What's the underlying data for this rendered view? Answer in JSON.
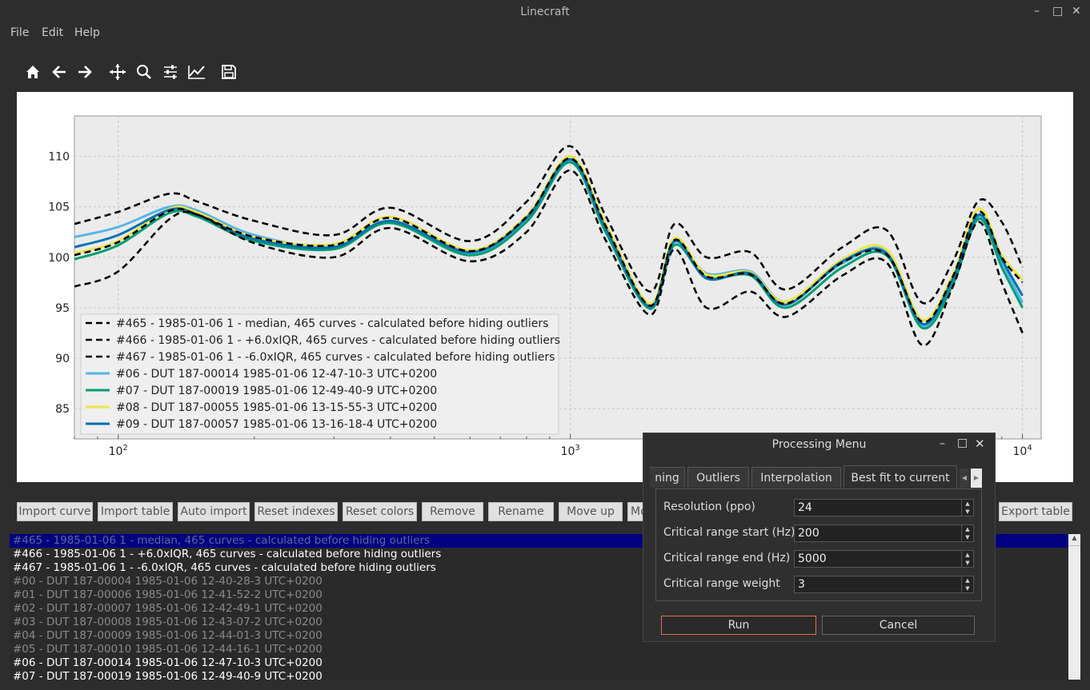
{
  "window": {
    "title": "Linecraft"
  },
  "menu": {
    "items": [
      "File",
      "Edit",
      "Help"
    ]
  },
  "toolbar": {
    "icons": [
      "home-icon",
      "back-icon",
      "forward-icon",
      "pan-icon",
      "zoom-icon",
      "configure-subplots-icon",
      "edit-axis-icon",
      "save-icon"
    ]
  },
  "chart_data": {
    "type": "line",
    "xscale": "log",
    "xlim": [
      80,
      11000
    ],
    "ylim": [
      82,
      114
    ],
    "xticks": [
      "10^2",
      "10^3",
      "10^4"
    ],
    "yticks": [
      85,
      90,
      95,
      100,
      105,
      110
    ],
    "grid": true,
    "legend_position": "lower-left",
    "legend": [
      {
        "label": "#465 - 1985-01-06 1 - median, 465 curves - calculated before hiding outliers",
        "style": "dashed",
        "color": "#000000"
      },
      {
        "label": "#466 - 1985-01-06 1 - +6.0xIQR, 465 curves - calculated before hiding outliers",
        "style": "dashed",
        "color": "#000000"
      },
      {
        "label": "#467 - 1985-01-06 1 - -6.0xIQR, 465 curves - calculated before hiding outliers",
        "style": "dashed",
        "color": "#000000"
      },
      {
        "label": "#06 - DUT 187-00014 1985-01-06 12-47-10-3 UTC+0200",
        "style": "solid",
        "color": "#56b4e9"
      },
      {
        "label": "#07 - DUT 187-00019 1985-01-06 12-49-40-9 UTC+0200",
        "style": "solid",
        "color": "#009e73"
      },
      {
        "label": "#08 - DUT 187-00055 1985-01-06 13-15-55-3 UTC+0200",
        "style": "solid",
        "color": "#f0e442"
      },
      {
        "label": "#09 - DUT 187-00057 1985-01-06 13-16-18-4 UTC+0200",
        "style": "solid",
        "color": "#0072b2"
      }
    ],
    "series": [
      {
        "name": "#465 - 1985-01-06 1 - median, 465 curves - calculated before hiding outliers",
        "color": "#000000",
        "dash": true,
        "x": [
          80,
          100,
          130,
          150,
          200,
          300,
          400,
          600,
          800,
          1000,
          1200,
          1500,
          1700,
          2000,
          2500,
          3000,
          4000,
          5000,
          6000,
          7000,
          8000,
          9000,
          10000
        ],
        "y": [
          100.2,
          101.5,
          104.6,
          104.2,
          102.0,
          101.2,
          103.9,
          100.6,
          104.0,
          109.8,
          103.0,
          95.2,
          101.7,
          98.1,
          98.3,
          95.4,
          99.5,
          100.3,
          93.6,
          98.0,
          104.5,
          100.0,
          97.5
        ]
      },
      {
        "name": "#466 - 1985-01-06 1 - +6.0xIQR, 465 curves - calculated before hiding outliers",
        "color": "#000000",
        "dash": true,
        "x": [
          80,
          100,
          130,
          150,
          200,
          300,
          400,
          600,
          800,
          1000,
          1200,
          1500,
          1700,
          2000,
          2500,
          3000,
          4000,
          5000,
          6000,
          7000,
          8000,
          9000,
          10000
        ],
        "y": [
          103.3,
          104.5,
          106.3,
          105.5,
          103.6,
          102.2,
          104.9,
          101.6,
          105.5,
          111.0,
          104.0,
          96.6,
          103.3,
          100.0,
          100.5,
          96.8,
          101.0,
          102.7,
          95.5,
          99.5,
          105.6,
          103.5,
          99.0
        ]
      },
      {
        "name": "#467 - 1985-01-06 1 - -6.0xIQR, 465 curves - calculated before hiding outliers",
        "color": "#000000",
        "dash": true,
        "x": [
          80,
          100,
          130,
          150,
          200,
          300,
          400,
          600,
          800,
          1000,
          1200,
          1500,
          1700,
          2000,
          2500,
          3000,
          4000,
          5000,
          6000,
          7000,
          8000,
          9000,
          10000
        ],
        "y": [
          97.1,
          98.6,
          103.8,
          104.2,
          101.4,
          100.0,
          102.9,
          99.6,
          102.5,
          108.6,
          101.6,
          94.3,
          100.8,
          95.0,
          96.6,
          94.1,
          98.2,
          99.5,
          91.3,
          97.0,
          103.5,
          97.5,
          92.5
        ]
      },
      {
        "name": "#06 - DUT 187-00014 1985-01-06 12-47-10-3 UTC+0200",
        "color": "#56b4e9",
        "dash": false,
        "x": [
          80,
          100,
          130,
          150,
          200,
          300,
          400,
          600,
          800,
          1000,
          1200,
          1500,
          1700,
          2000,
          2500,
          3000,
          4000,
          5000,
          6000,
          7000,
          8000,
          9000,
          10000
        ],
        "y": [
          102.0,
          103.0,
          105.0,
          104.6,
          102.2,
          101.0,
          103.5,
          100.4,
          103.8,
          109.6,
          102.6,
          95.0,
          101.5,
          98.4,
          98.6,
          95.6,
          99.4,
          100.6,
          93.2,
          97.5,
          104.0,
          99.5,
          95.5
        ]
      },
      {
        "name": "#07 - DUT 187-00019 1985-01-06 12-49-40-9 UTC+0200",
        "color": "#009e73",
        "dash": false,
        "x": [
          80,
          100,
          130,
          150,
          200,
          300,
          400,
          600,
          800,
          1000,
          1200,
          1500,
          1700,
          2000,
          2500,
          3000,
          4000,
          5000,
          6000,
          7000,
          8000,
          9000,
          10000
        ],
        "y": [
          99.8,
          101.2,
          104.4,
          104.0,
          101.6,
          100.8,
          103.4,
          100.2,
          103.5,
          109.4,
          102.4,
          94.9,
          101.2,
          98.0,
          98.2,
          95.0,
          99.0,
          100.2,
          93.0,
          97.2,
          103.8,
          99.0,
          95.0
        ]
      },
      {
        "name": "#08 - DUT 187-00055 1985-01-06 13-15-55-3 UTC+0200",
        "color": "#f0e442",
        "dash": false,
        "x": [
          80,
          100,
          130,
          150,
          200,
          300,
          400,
          600,
          800,
          1000,
          1200,
          1500,
          1700,
          2000,
          2500,
          3000,
          4000,
          5000,
          6000,
          7000,
          8000,
          9000,
          10000
        ],
        "y": [
          100.4,
          101.6,
          104.8,
          104.4,
          102.0,
          101.3,
          104.0,
          100.7,
          104.1,
          110.0,
          103.2,
          95.4,
          101.9,
          98.3,
          98.5,
          95.6,
          99.8,
          100.8,
          93.8,
          98.2,
          104.8,
          100.2,
          97.8
        ]
      },
      {
        "name": "#09 - DUT 187-00057 1985-01-06 13-16-18-4 UTC+0200",
        "color": "#0072b2",
        "dash": false,
        "x": [
          80,
          100,
          130,
          150,
          200,
          300,
          400,
          600,
          800,
          1000,
          1200,
          1500,
          1700,
          2000,
          2500,
          3000,
          4000,
          5000,
          6000,
          7000,
          8000,
          9000,
          10000
        ],
        "y": [
          101.0,
          102.2,
          104.7,
          104.2,
          101.8,
          101.0,
          103.6,
          100.5,
          103.9,
          109.7,
          102.8,
          95.1,
          101.6,
          97.9,
          98.4,
          95.3,
          99.6,
          100.4,
          93.4,
          97.8,
          104.2,
          99.8,
          96.2
        ]
      }
    ]
  },
  "buttons": {
    "import_curve": "Import curve",
    "import_table": "Import table",
    "auto_import": "Auto import",
    "reset_indexes": "Reset indexes",
    "reset_colors": "Reset colors",
    "remove": "Remove",
    "rename": "Rename",
    "move_up": "Move up",
    "move_down_partial": "Mo",
    "export_table": "Export table"
  },
  "curve_list": [
    {
      "label": "#465 - 1985-01-06 1 - median, 465 curves - calculated before hiding outliers",
      "selected": true
    },
    {
      "label": "#466 - 1985-01-06 1 - +6.0xIQR, 465 curves - calculated before hiding outliers",
      "visible": true
    },
    {
      "label": "#467 - 1985-01-06 1 - -6.0xIQR, 465 curves - calculated before hiding outliers",
      "visible": true
    },
    {
      "label": "#00 - DUT 187-00004 1985-01-06 12-40-28-3 UTC+0200",
      "visible": false
    },
    {
      "label": "#01 - DUT 187-00006 1985-01-06 12-41-52-2 UTC+0200",
      "visible": false
    },
    {
      "label": "#02 - DUT 187-00007 1985-01-06 12-42-49-1 UTC+0200",
      "visible": false
    },
    {
      "label": "#03 - DUT 187-00008 1985-01-06 12-43-07-2 UTC+0200",
      "visible": false
    },
    {
      "label": "#04 - DUT 187-00009 1985-01-06 12-44-01-3 UTC+0200",
      "visible": false
    },
    {
      "label": "#05 - DUT 187-00010 1985-01-06 12-44-16-1 UTC+0200",
      "visible": false
    },
    {
      "label": "#06 - DUT 187-00014 1985-01-06 12-47-10-3 UTC+0200",
      "visible": true
    },
    {
      "label": "#07 - DUT 187-00019 1985-01-06 12-49-40-9 UTC+0200",
      "visible": true
    }
  ],
  "dialog": {
    "title": "Processing Menu",
    "tabs": [
      "ning",
      "Outliers",
      "Interpolation",
      "Best fit to current"
    ],
    "active_tab": "Best fit to current",
    "fields": [
      {
        "label": "Resolution (ppo)",
        "value": "24"
      },
      {
        "label": "Critical range start (Hz)",
        "value": "200"
      },
      {
        "label": "Critical range end (Hz)",
        "value": "5000"
      },
      {
        "label": "Critical range weight",
        "value": "3"
      }
    ],
    "run_label": "Run",
    "cancel_label": "Cancel"
  },
  "colors": {
    "selection": "#000080",
    "run_border": "#e07050",
    "plot_bg": "#ebebeb"
  }
}
